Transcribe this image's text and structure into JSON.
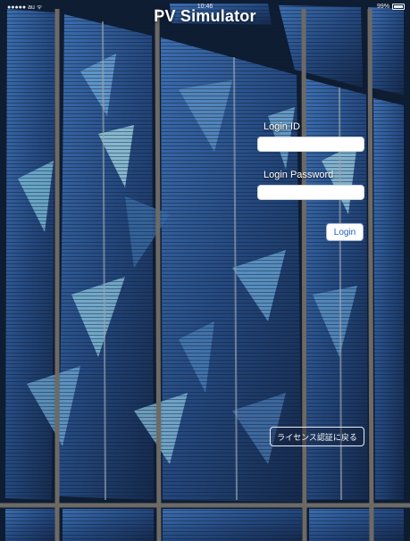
{
  "status_bar": {
    "carrier": "●●●●● au ᯤ",
    "time": "10:46",
    "battery": "99%",
    "battery_icon": "battery-icon"
  },
  "app": {
    "title": "PV Simulator"
  },
  "login_form": {
    "login_id_label": "Login ID",
    "login_id_value": "",
    "password_label": "Login Password",
    "password_value": "",
    "login_button": "Login"
  },
  "footer": {
    "license_button": "ライセンス認証に戻る"
  },
  "colors": {
    "title_text": "#ffffff",
    "button_text": "#1f5fb5",
    "background_dark": "#1b2e4e",
    "panel_blue": "#2b4f86"
  }
}
